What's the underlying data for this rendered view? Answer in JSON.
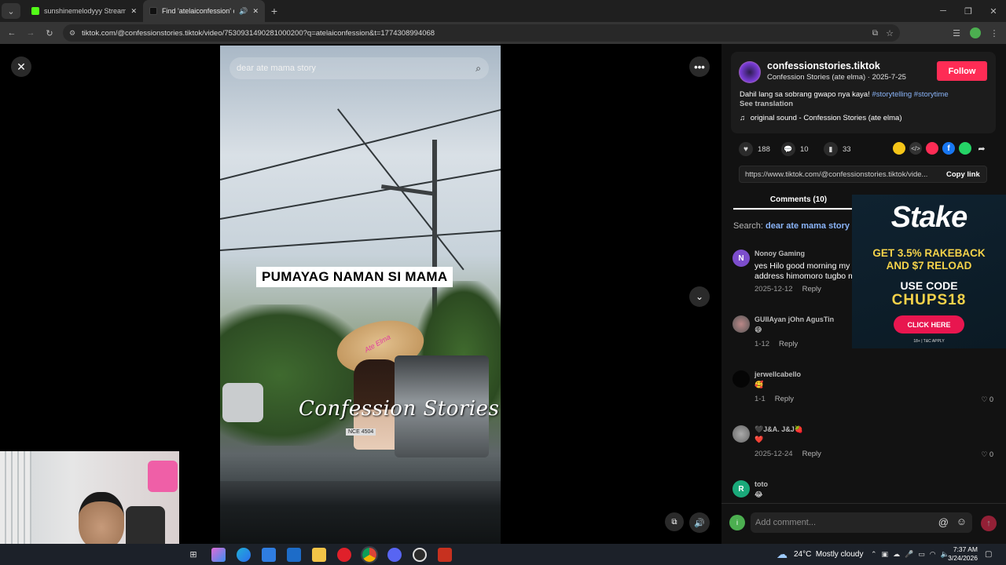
{
  "browser": {
    "tabs": [
      {
        "title": "sunshinemelodyyy Stream - Wa",
        "color": "#53fc18"
      },
      {
        "title": "Find 'atelaiconfession' on Ti",
        "color": "#000000"
      }
    ],
    "url": "tiktok.com/@confessionstories.tiktok/video/7530931490281000200?q=atelaiconfession&t=1774308994068"
  },
  "video": {
    "search_placeholder": "dear ate mama story",
    "caption": "PUMAYAG NAMAN SI MAMA",
    "watermark": "Confession Stories",
    "hat_text": "Ate Elma",
    "plate": "NCE 4504"
  },
  "post": {
    "username": "confessionstories.tiktok",
    "display_and_date": "Confession Stories (ate elma) · 2025-7-25",
    "follow": "Follow",
    "description": "Dahil lang sa sobrang gwapo nya kaya!",
    "hashtags": "#storytelling #storytime",
    "see_translation": "See translation",
    "sound": "original sound - Confession Stories (ate elma)",
    "likes": "188",
    "comments": "10",
    "saves": "33",
    "link": "https://www.tiktok.com/@confessionstories.tiktok/vide...",
    "copy_link": "Copy link",
    "comments_tab": "Comments (10)",
    "search_label": "Search:",
    "search_term": "dear ate mama story"
  },
  "comments": [
    {
      "name": "Nonoy Gaming",
      "text": "yes Hilo good morning my",
      "text2": "address himomoro tugbo m",
      "date": "2025-12-12",
      "reply": "Reply",
      "initial": "N",
      "color": "#7c4dcc"
    },
    {
      "name": "GUIIAyan jOhn AgusTin",
      "text": "😅",
      "date": "1-12",
      "reply": "Reply",
      "color": "#6d6d6d"
    },
    {
      "name": "jerwellcabello",
      "text": "🥰",
      "date": "1-1",
      "reply": "Reply",
      "likes": "0",
      "color": "#000000"
    },
    {
      "name": "🖤J&A. J&J🍓",
      "text": "❤️",
      "date": "2025-12-24",
      "reply": "Reply",
      "likes": "0",
      "color": "#888888"
    },
    {
      "name": "toto",
      "text": "😂",
      "initial": "R",
      "color": "#1aa97a"
    }
  ],
  "comment_input": {
    "placeholder": "Add comment..."
  },
  "ad": {
    "brand": "Stake",
    "line1": "GET 3.5% RAKEBACK",
    "line2": "AND $7 RELOAD",
    "code_label": "USE CODE",
    "code": "CHUPS18",
    "cta": "CLICK HERE",
    "footer": "18+ | T&C APPLY"
  },
  "taskbar": {
    "weather": "24°C  Mostly cloudy",
    "time": "7:37 AM",
    "date": "3/24/2026"
  }
}
